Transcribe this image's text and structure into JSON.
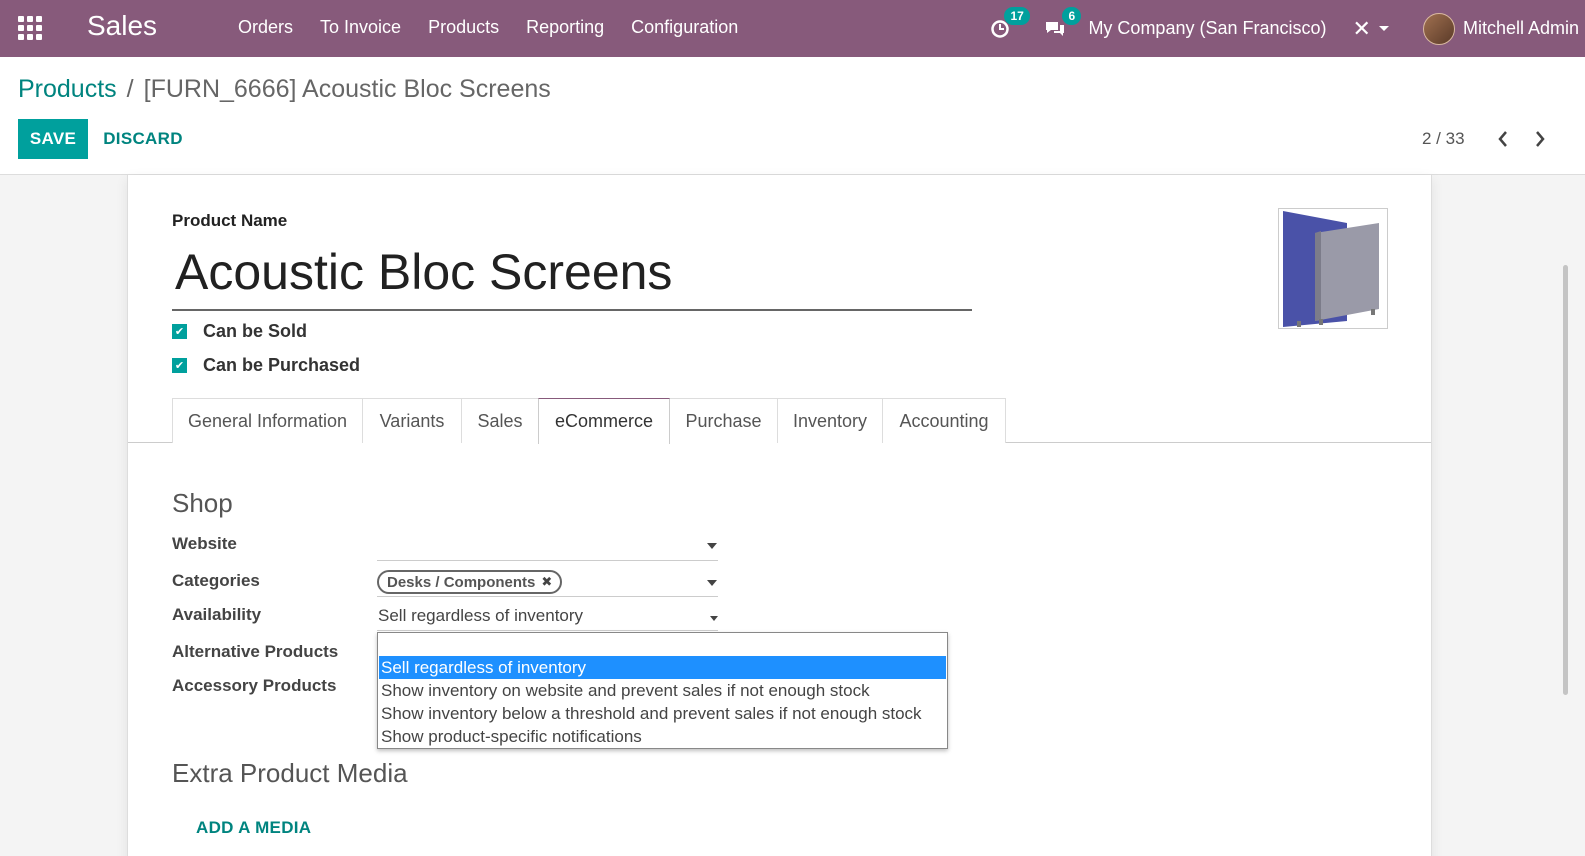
{
  "navbar": {
    "app_name": "Sales",
    "menu": [
      "Orders",
      "To Invoice",
      "Products",
      "Reporting",
      "Configuration"
    ],
    "activity_count": "17",
    "messages_count": "6",
    "company": "My Company (San Francisco)",
    "user": "Mitchell Admin",
    "color": "#875a7b"
  },
  "breadcrumb": {
    "parent": "Products",
    "separator": "/",
    "current": "[FURN_6666] Acoustic Bloc Screens"
  },
  "buttons": {
    "save": "SAVE",
    "discard": "DISCARD"
  },
  "pager": {
    "value": "2 / 33"
  },
  "product": {
    "name_label": "Product Name",
    "name": "Acoustic Bloc Screens",
    "can_be_sold": "Can be Sold",
    "can_be_purchased": "Can be Purchased"
  },
  "tabs": [
    "General Information",
    "Variants",
    "Sales",
    "eCommerce",
    "Purchase",
    "Inventory",
    "Accounting"
  ],
  "active_tab": "eCommerce",
  "shop": {
    "title": "Shop",
    "website_label": "Website",
    "website_value": "",
    "categories_label": "Categories",
    "category_tag": "Desks / Components",
    "availability_label": "Availability",
    "availability_value": "Sell regardless of inventory",
    "alternative_label": "Alternative Products",
    "accessory_label": "Accessory Products"
  },
  "availability_options": [
    "",
    "Sell regardless of inventory",
    "Show inventory on website and prevent sales if not enough stock",
    "Show inventory below a threshold and prevent sales if not enough stock",
    "Show product-specific notifications"
  ],
  "media": {
    "title": "Extra Product Media",
    "add_label": "ADD A MEDIA"
  },
  "accent_color": "#00a09d"
}
